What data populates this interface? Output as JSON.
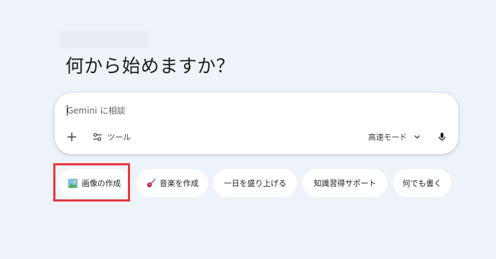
{
  "heading": "何から始めますか？",
  "composer": {
    "placeholder": "Gemini に相談",
    "tools_label": "ツール",
    "mode_label": "高速モード"
  },
  "chips": [
    {
      "label": "画像の作成",
      "icon": "image-icon"
    },
    {
      "label": "音楽を作成",
      "icon": "guitar-icon"
    },
    {
      "label": "一日を盛り上げる",
      "icon": ""
    },
    {
      "label": "知識習得サポート",
      "icon": ""
    },
    {
      "label": "何でも書く",
      "icon": ""
    }
  ],
  "colors": {
    "page_background": "#eef2f9",
    "highlight": "#e5373b"
  },
  "icons": {
    "add": "plus-icon",
    "tools": "tune-icon",
    "mode": "chevron-down-icon",
    "mic": "microphone-icon"
  }
}
